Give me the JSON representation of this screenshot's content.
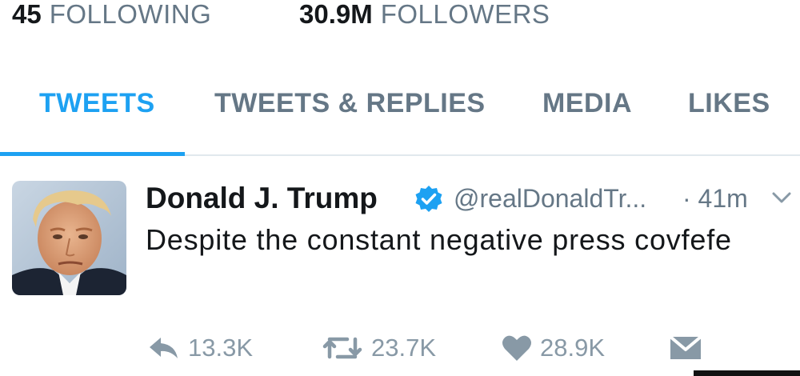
{
  "profile_stats": {
    "following_count": "45",
    "following_label": "FOLLOWING",
    "followers_count": "30.9M",
    "followers_label": "FOLLOWERS"
  },
  "tabs": [
    {
      "label": "TWEETS",
      "active": true
    },
    {
      "label": "TWEETS & REPLIES",
      "active": false
    },
    {
      "label": "MEDIA",
      "active": false
    },
    {
      "label": "LIKES",
      "active": false
    }
  ],
  "tweet": {
    "author_name": "Donald J. Trump",
    "verified": true,
    "handle": "@realDonaldTr...",
    "time": "· 41m",
    "text": "Despite the constant negative press covfefe",
    "replies": "13.3K",
    "retweets": "23.7K",
    "likes": "28.9K"
  },
  "icons": {
    "verified": "verified-badge-icon",
    "more": "chevron-down-icon",
    "reply": "reply-arrow-icon",
    "retweet": "retweet-icon",
    "like": "heart-icon",
    "dm": "envelope-icon"
  },
  "colors": {
    "accent": "#1da1f2",
    "muted_text": "#657786",
    "action_gray": "#8899a6",
    "divider": "#e1e8ed"
  }
}
